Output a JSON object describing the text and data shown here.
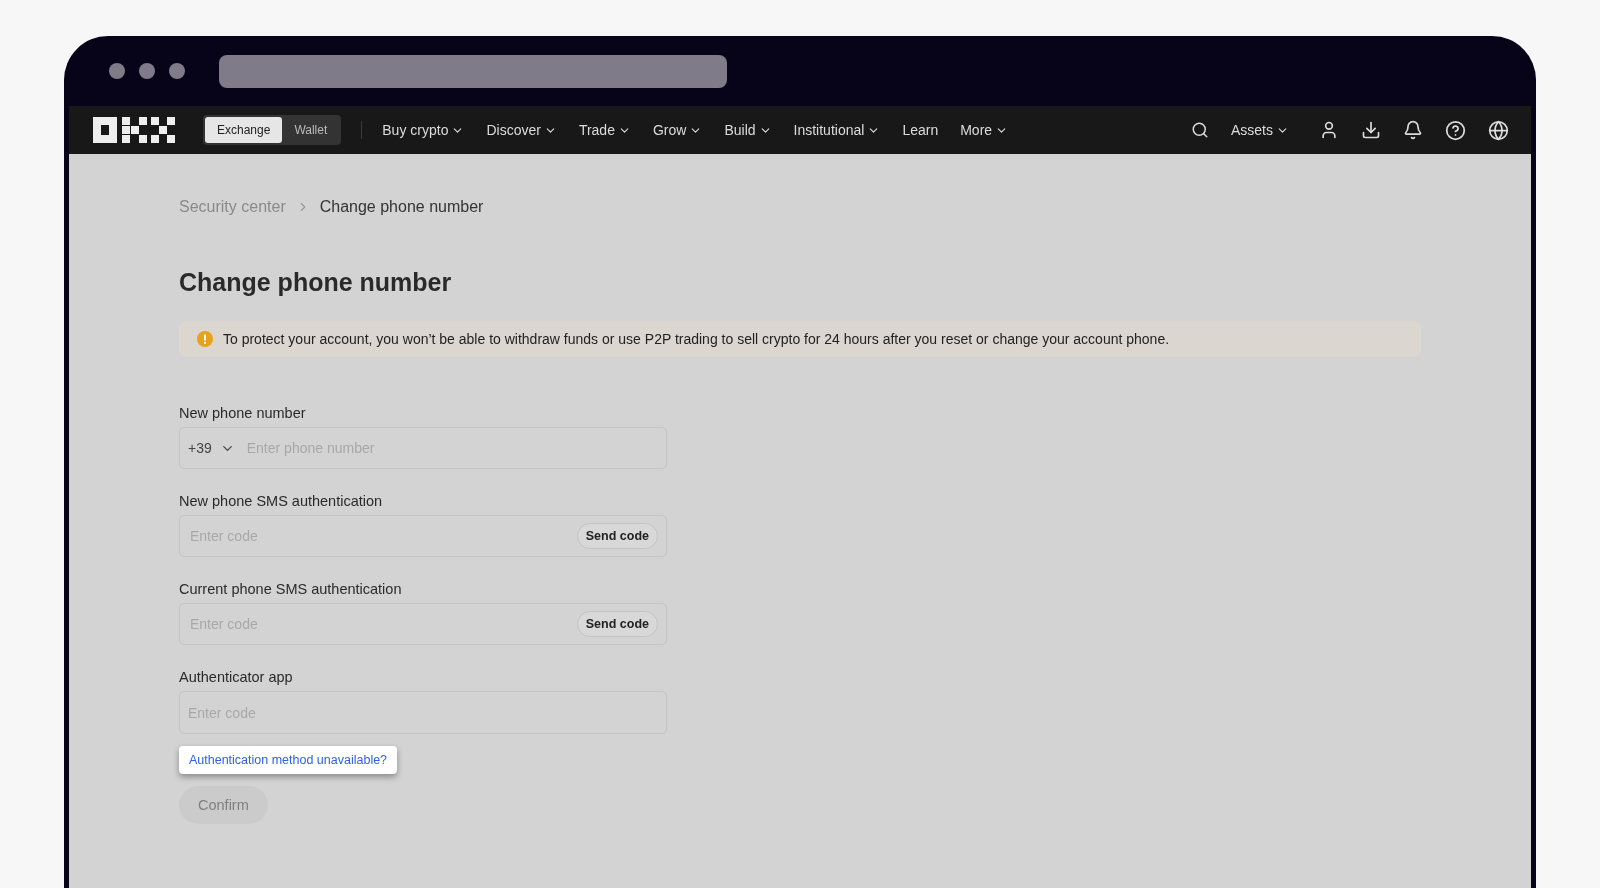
{
  "nav": {
    "switch": [
      {
        "label": "Exchange",
        "selected": true
      },
      {
        "label": "Wallet",
        "selected": false
      }
    ],
    "menu": [
      {
        "label": "Buy crypto",
        "dropdown": true
      },
      {
        "label": "Discover",
        "dropdown": true
      },
      {
        "label": "Trade",
        "dropdown": true
      },
      {
        "label": "Grow",
        "dropdown": true
      },
      {
        "label": "Build",
        "dropdown": true
      },
      {
        "label": "Institutional",
        "dropdown": true
      },
      {
        "label": "Learn",
        "dropdown": false
      },
      {
        "label": "More",
        "dropdown": true
      }
    ],
    "assets": "Assets"
  },
  "breadcrumb": [
    "Security center",
    "Change phone number"
  ],
  "title": "Change phone number",
  "notice": "To protect your account, you won’t be able to withdraw funds or use P2P trading to sell crypto for 24 hours after you reset or change your account phone.",
  "fields": [
    {
      "kind": "phone",
      "label": "New phone number",
      "prefix": "+39",
      "placeholder": "Enter phone number"
    },
    {
      "kind": "code",
      "label": "New phone SMS authentication",
      "placeholder": "Enter code",
      "button": "Send code"
    },
    {
      "kind": "code",
      "label": "Current phone SMS authentication",
      "placeholder": "Enter code",
      "button": "Send code"
    },
    {
      "kind": "plain",
      "label": "Authenticator app",
      "placeholder": "Enter code"
    }
  ],
  "help_link": "Authentication method unavailable?",
  "confirm": {
    "label": "Confirm",
    "disabled": true
  }
}
